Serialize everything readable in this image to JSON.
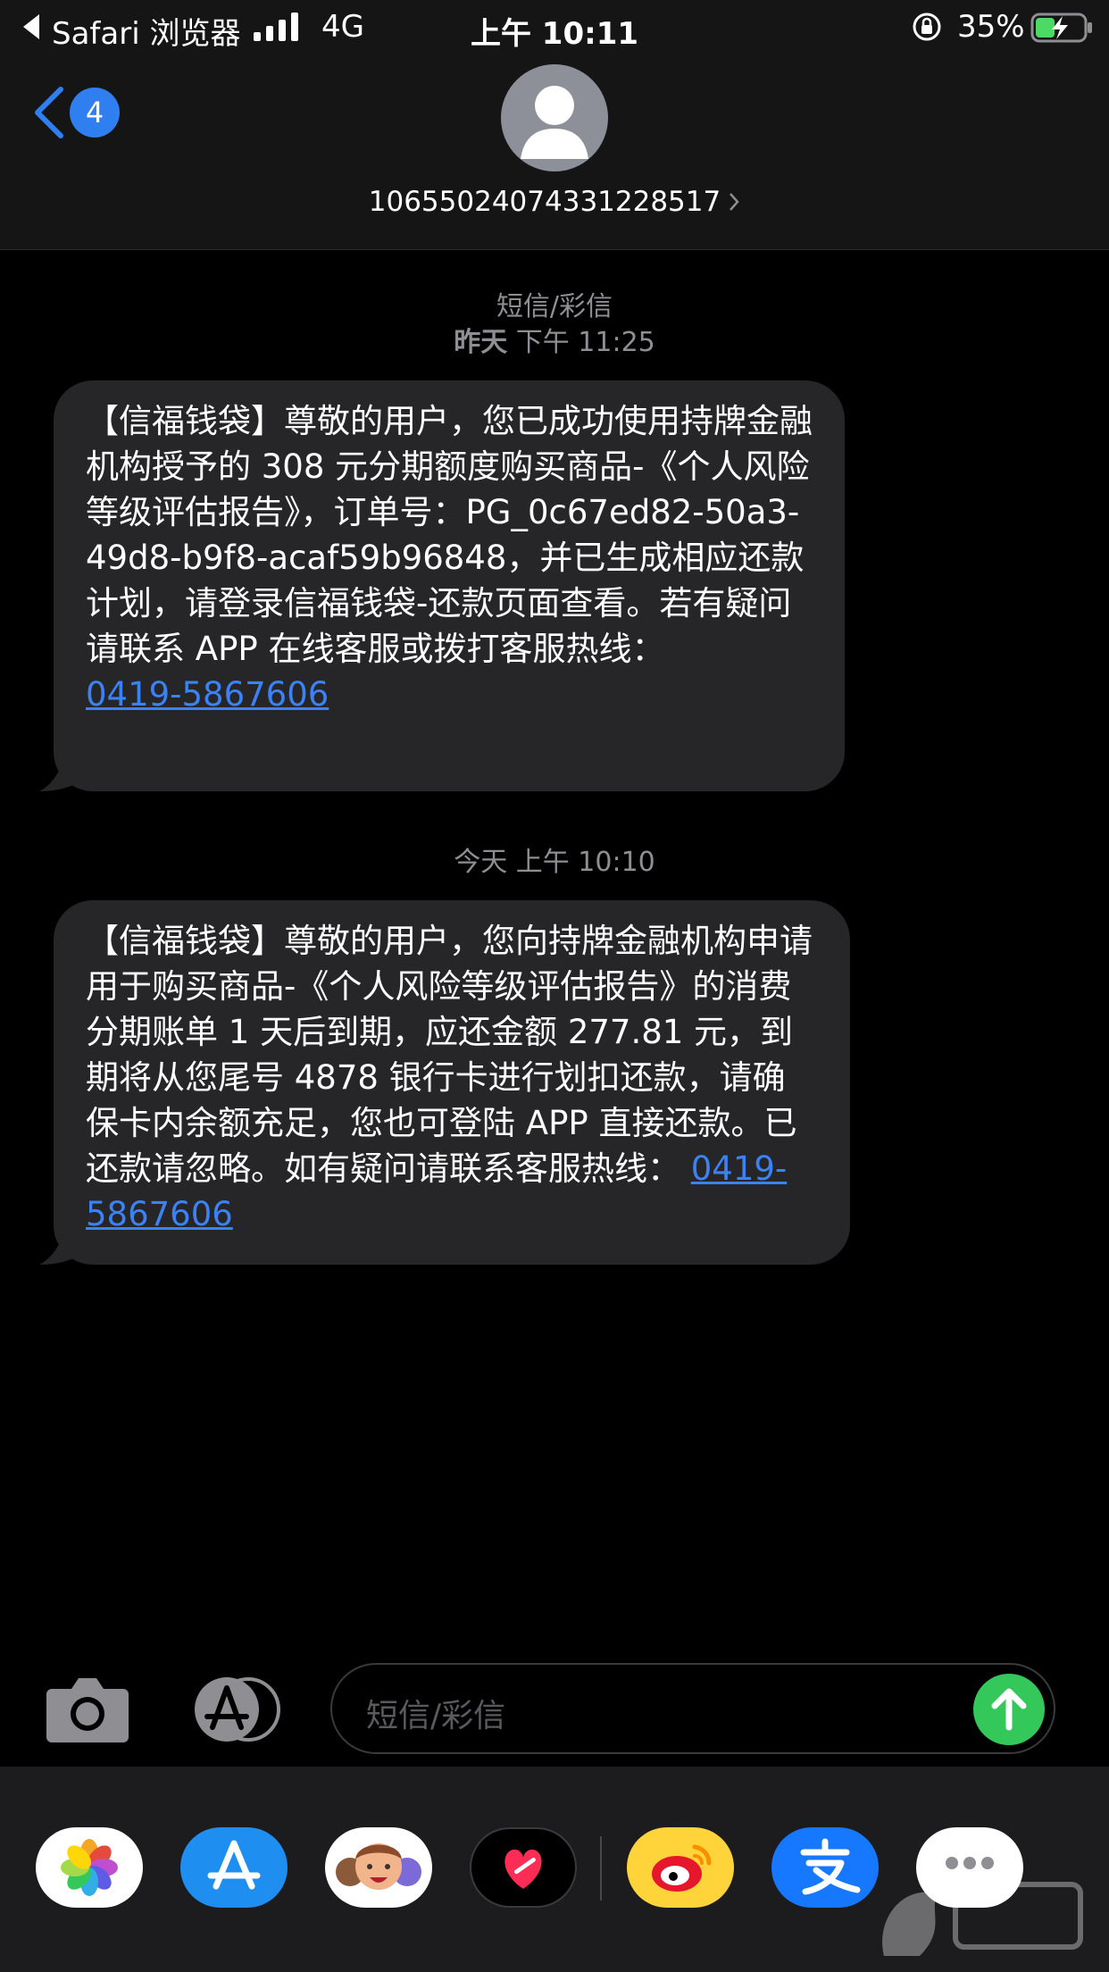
{
  "status_bar": {
    "back_app": "Safari 浏览器",
    "network": "4G",
    "time": "上午 10:11",
    "battery": "35%"
  },
  "header": {
    "back_badge": "4",
    "contact": "10655024074331228517"
  },
  "conversation": {
    "service_label": "短信/彩信",
    "messages": [
      {
        "timestamp_day": "昨天",
        "timestamp_time": "下午 11:25",
        "text": "【信福钱袋】尊敬的用户，您已成功使用持牌金融机构授予的 308 元分期额度购买商品-《个人风险等级评估报告》，订单号：PG_0c67ed82-50a3-49d8-b9f8-acaf59b96848，并已生成相应还款计划，请登录信福钱袋-还款页面查看。若有疑问请联系 APP 在线客服或拨打客服热线：",
        "phone": "0419-5867606"
      },
      {
        "timestamp_day": "今天",
        "timestamp_time": "上午 10:10",
        "text": "【信福钱袋】尊敬的用户，您向持牌金融机构申请用于购买商品-《个人风险等级评估报告》的消费分期账单 1 天后到期，应还金额 277.81 元，到期将从您尾号 4878 银行卡进行划扣还款，请确保卡内余额充足，您也可登陆 APP 直接还款。已还款请忽略。如有疑问请联系客服热线：",
        "phone": "0419-5867606"
      }
    ]
  },
  "input": {
    "placeholder": "短信/彩信"
  },
  "app_drawer": {
    "apps": [
      "photos-icon",
      "app-store-icon",
      "memoji-icon",
      "digital-touch-icon",
      "weibo-icon",
      "alipay-icon",
      "more-icon"
    ]
  },
  "colors": {
    "bubble": "#262628",
    "link": "#3b82f6",
    "send": "#34c759",
    "badge": "#2f7ff0"
  }
}
